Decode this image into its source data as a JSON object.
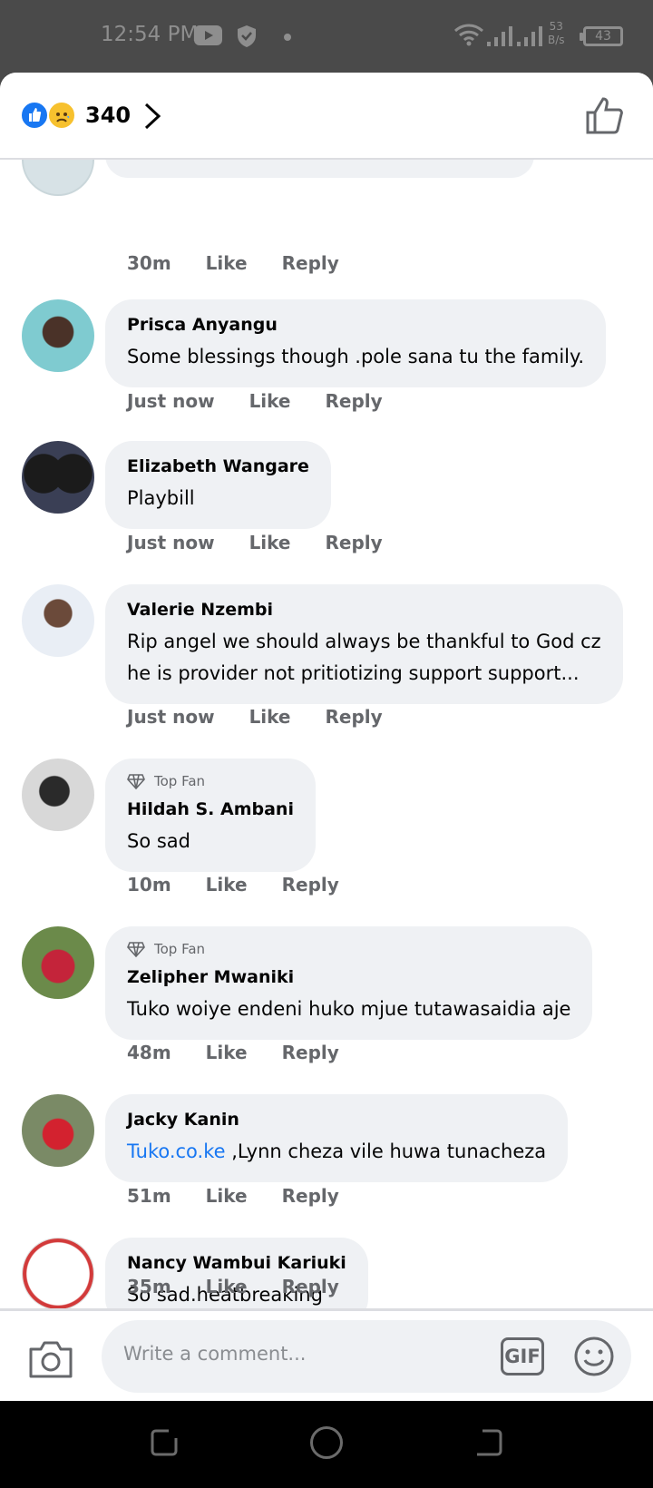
{
  "status_bar": {
    "time": "12:54 PM",
    "speed_value": "53",
    "speed_unit": "B/s",
    "battery": "43",
    "icons": [
      "youtube-icon",
      "shield-icon",
      "dot-icon",
      "wifi-icon",
      "signal-icon",
      "signal-icon",
      "battery-icon"
    ]
  },
  "header": {
    "reactions": [
      "like-reaction-icon",
      "sad-reaction-icon"
    ],
    "reaction_count": "340",
    "accent_color": "#1877f2"
  },
  "comments": [
    {
      "name": "Prisca Anyangu",
      "text": "Some blessings though .pole sana tu the family.",
      "time": "Just now",
      "like": "Like",
      "reply": "Reply",
      "top_fan": ""
    },
    {
      "name": "Elizabeth Wangare",
      "text": "Playbill",
      "time": "Just now",
      "like": "Like",
      "reply": "Reply",
      "top_fan": ""
    },
    {
      "name": "Valerie Nzembi",
      "text_line1": "Rip angel  we should always be thankful to God cz",
      "text_line2": "he is provider not pritiotizing support support...",
      "time": "Just now",
      "like": "Like",
      "reply": "Reply",
      "top_fan": ""
    },
    {
      "name": "Hildah S. Ambani",
      "text": "So sad",
      "time": "10m",
      "like": "Like",
      "reply": "Reply",
      "top_fan": "Top Fan"
    },
    {
      "name": "Zelipher Mwaniki",
      "text": "Tuko woiye endeni huko mjue tutawasaidia aje",
      "time": "48m",
      "like": "Like",
      "reply": "Reply",
      "top_fan": "Top Fan"
    },
    {
      "name": "Jacky Kanin",
      "link": "Tuko.co.ke",
      "text": " ,Lynn cheza vile huwa tunacheza",
      "time": "51m",
      "like": "Like",
      "reply": "Reply",
      "top_fan": ""
    },
    {
      "name": "Nancy Wambui Kariuki",
      "text": "So sad.heatbreaking",
      "time": "35m",
      "like": "Like",
      "reply": "Reply",
      "top_fan": ""
    }
  ],
  "partial_comment": {
    "time": "30m",
    "like": "Like",
    "reply": "Reply"
  },
  "composer": {
    "placeholder": "Write a comment...",
    "gif_label": "GIF"
  }
}
